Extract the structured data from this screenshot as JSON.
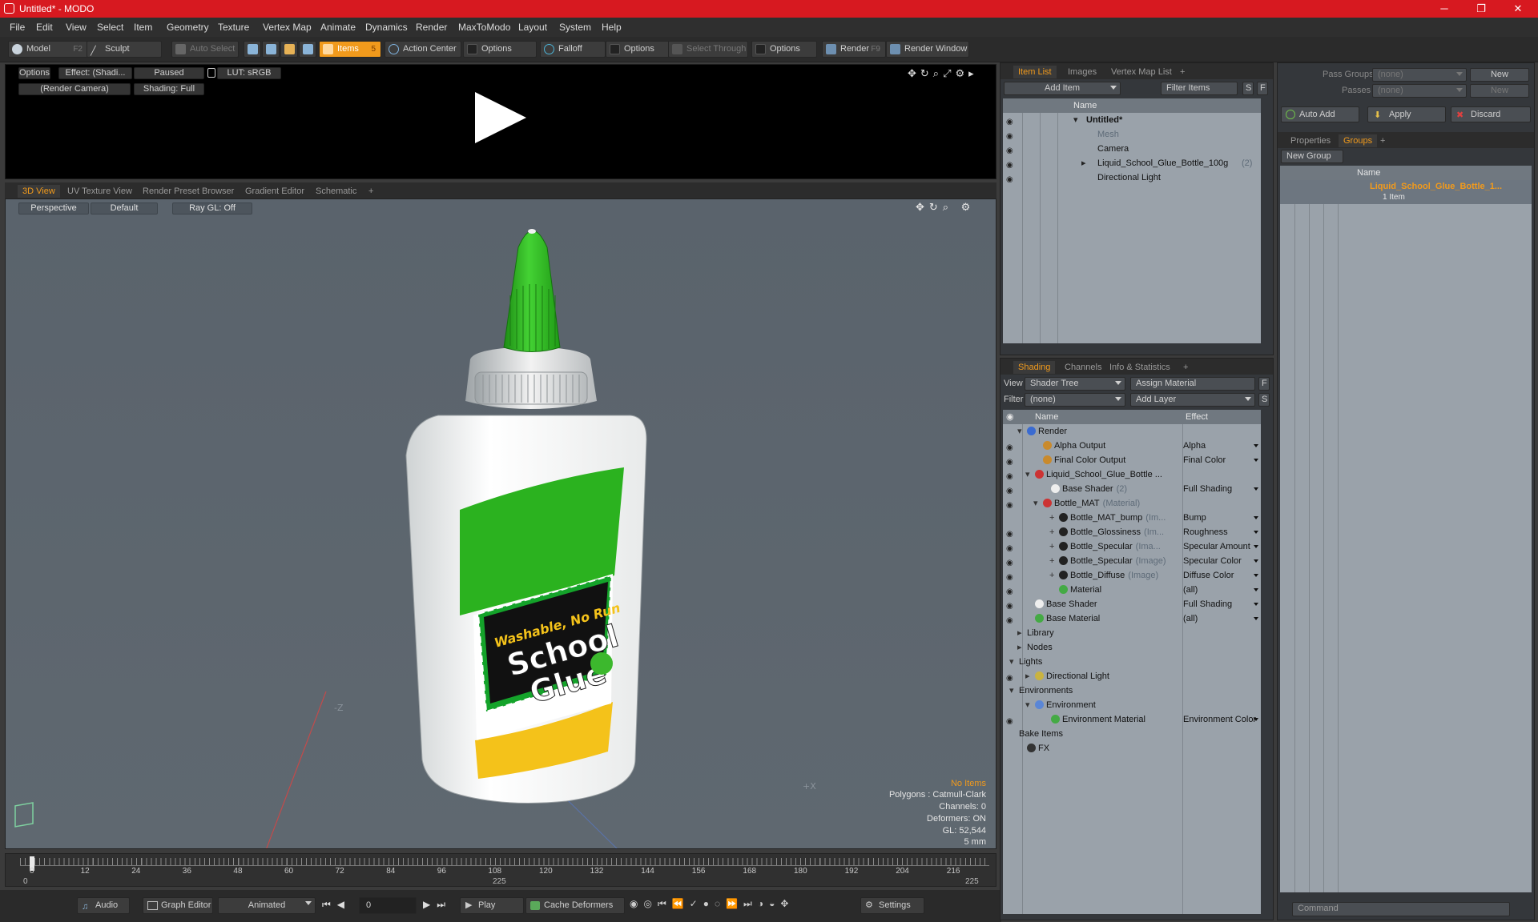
{
  "window": {
    "title": "Untitled* - MODO",
    "minimize": "─",
    "maximize": "❐",
    "close": "✕"
  },
  "menu": [
    "File",
    "Edit",
    "View",
    "Select",
    "Item",
    "Geometry",
    "Texture",
    "Vertex Map",
    "Animate",
    "Dynamics",
    "Render",
    "MaxToModo",
    "Layout",
    "System",
    "Help"
  ],
  "toolbar": {
    "model": "Model",
    "model_key": "F2",
    "sculpt": "Sculpt",
    "auto_select": "Auto Select",
    "items": "Items",
    "items_key": "5",
    "action_center": "Action Center",
    "options1": "Options",
    "falloff": "Falloff",
    "options2": "Options",
    "select_through": "Select Through",
    "options3": "Options",
    "render": "Render",
    "render_key": "F9",
    "render_window": "Render Window"
  },
  "preview": {
    "options": "Options",
    "effect": "Effect: (Shadi...",
    "paused": "Paused",
    "lut": "LUT: sRGB",
    "camera": "(Render Camera)",
    "shading": "Shading: Full"
  },
  "viewport_tabs": {
    "tabs": [
      "3D View",
      "UV Texture View",
      "Render Preset Browser",
      "Gradient Editor",
      "Schematic"
    ],
    "add": "+"
  },
  "viewport": {
    "perspective": "Perspective",
    "default": "Default",
    "raygl": "Ray GL: Off",
    "axis_z": "-Z",
    "axis_x": "+X",
    "label": {
      "line1": "Washable, No Run",
      "line2": "School",
      "line3": "Glue"
    },
    "hud": {
      "no_items": "No Items",
      "polygons": "Polygons : Catmull-Clark",
      "channels": "Channels: 0",
      "deformers": "Deformers: ON",
      "gl": "GL: 52,544",
      "unit": "5 mm"
    }
  },
  "timeline": {
    "ticks": [
      "0",
      "12",
      "24",
      "36",
      "48",
      "60",
      "72",
      "84",
      "96",
      "108",
      "120",
      "132",
      "144",
      "156",
      "168",
      "180",
      "192",
      "204",
      "216"
    ],
    "start": "0",
    "mid": "225",
    "end": "225"
  },
  "bottombar": {
    "audio": "Audio",
    "graph_editor": "Graph Editor",
    "animated": "Animated",
    "frame": "0",
    "play": "Play",
    "cache_deformers": "Cache Deformers",
    "settings": "Settings"
  },
  "item_list": {
    "tabs": [
      "Item List",
      "Images",
      "Vertex Map List"
    ],
    "add_item": "Add Item",
    "filter_items": "Filter Items",
    "btn_s": "S",
    "btn_f": "F",
    "col_name": "Name",
    "rows": [
      {
        "label": "Untitled*",
        "extra": ""
      },
      {
        "label": "Mesh",
        "extra": ""
      },
      {
        "label": "Camera",
        "extra": ""
      },
      {
        "label": "Liquid_School_Glue_Bottle_100g",
        "extra": "(2)"
      },
      {
        "label": "Directional Light",
        "extra": ""
      }
    ]
  },
  "shading": {
    "tabs": [
      "Shading",
      "Channels",
      "Info & Statistics"
    ],
    "view_label": "View",
    "view_value": "Shader Tree",
    "assign_material": "Assign Material",
    "filter_label": "Filter",
    "filter_value": "(none)",
    "add_layer": "Add Layer",
    "btn_f": "F",
    "btn_s": "S",
    "col_name": "Name",
    "col_effect": "Effect",
    "rows": [
      {
        "label": "Render",
        "extra": "",
        "effect": ""
      },
      {
        "label": "Alpha Output",
        "extra": "",
        "effect": "Alpha"
      },
      {
        "label": "Final Color Output",
        "extra": "",
        "effect": "Final Color"
      },
      {
        "label": "Liquid_School_Glue_Bottle ...",
        "extra": "",
        "effect": ""
      },
      {
        "label": "Base Shader",
        "extra": "(2)",
        "effect": "Full Shading"
      },
      {
        "label": "Bottle_MAT",
        "extra": "(Material)",
        "effect": ""
      },
      {
        "label": "Bottle_MAT_bump",
        "extra": "(Im...",
        "effect": "Bump"
      },
      {
        "label": "Bottle_Glossiness",
        "extra": "(Im...",
        "effect": "Roughness"
      },
      {
        "label": "Bottle_Specular",
        "extra": "(Ima...",
        "effect": "Specular Amount"
      },
      {
        "label": "Bottle_Specular",
        "extra": "(Image)",
        "effect": "Specular Color"
      },
      {
        "label": "Bottle_Diffuse",
        "extra": "(Image)",
        "effect": "Diffuse Color"
      },
      {
        "label": "Material",
        "extra": "",
        "effect": "(all)"
      },
      {
        "label": "Base Shader",
        "extra": "",
        "effect": "Full Shading"
      },
      {
        "label": "Base Material",
        "extra": "",
        "effect": "(all)"
      },
      {
        "label": "Library",
        "extra": "",
        "effect": ""
      },
      {
        "label": "Nodes",
        "extra": "",
        "effect": ""
      },
      {
        "label": "Lights",
        "extra": "",
        "effect": ""
      },
      {
        "label": "Directional Light",
        "extra": "",
        "effect": ""
      },
      {
        "label": "Environments",
        "extra": "",
        "effect": ""
      },
      {
        "label": "Environment",
        "extra": "",
        "effect": ""
      },
      {
        "label": "Environment Material",
        "extra": "",
        "effect": "Environment Color"
      },
      {
        "label": "Bake Items",
        "extra": "",
        "effect": ""
      },
      {
        "label": "FX",
        "extra": "",
        "effect": ""
      }
    ]
  },
  "right_panel": {
    "pass_groups": "Pass Groups",
    "pass_groups_value": "(none)",
    "passes": "Passes",
    "passes_value": "(none)",
    "new": "New",
    "new2": "New",
    "auto_add": "Auto Add",
    "apply": "Apply",
    "discard": "Discard",
    "tabs": [
      "Properties",
      "Groups"
    ],
    "new_group": "New Group",
    "col_name": "Name",
    "group_name": "Liquid_School_Glue_Bottle_1...",
    "group_count": "1 Item"
  },
  "command": {
    "placeholder": "Command"
  },
  "colors": {
    "accent": "#f19a1c",
    "title": "#d71920",
    "glue_green": "#2bb21f",
    "label_yellow": "#f4c21a"
  }
}
